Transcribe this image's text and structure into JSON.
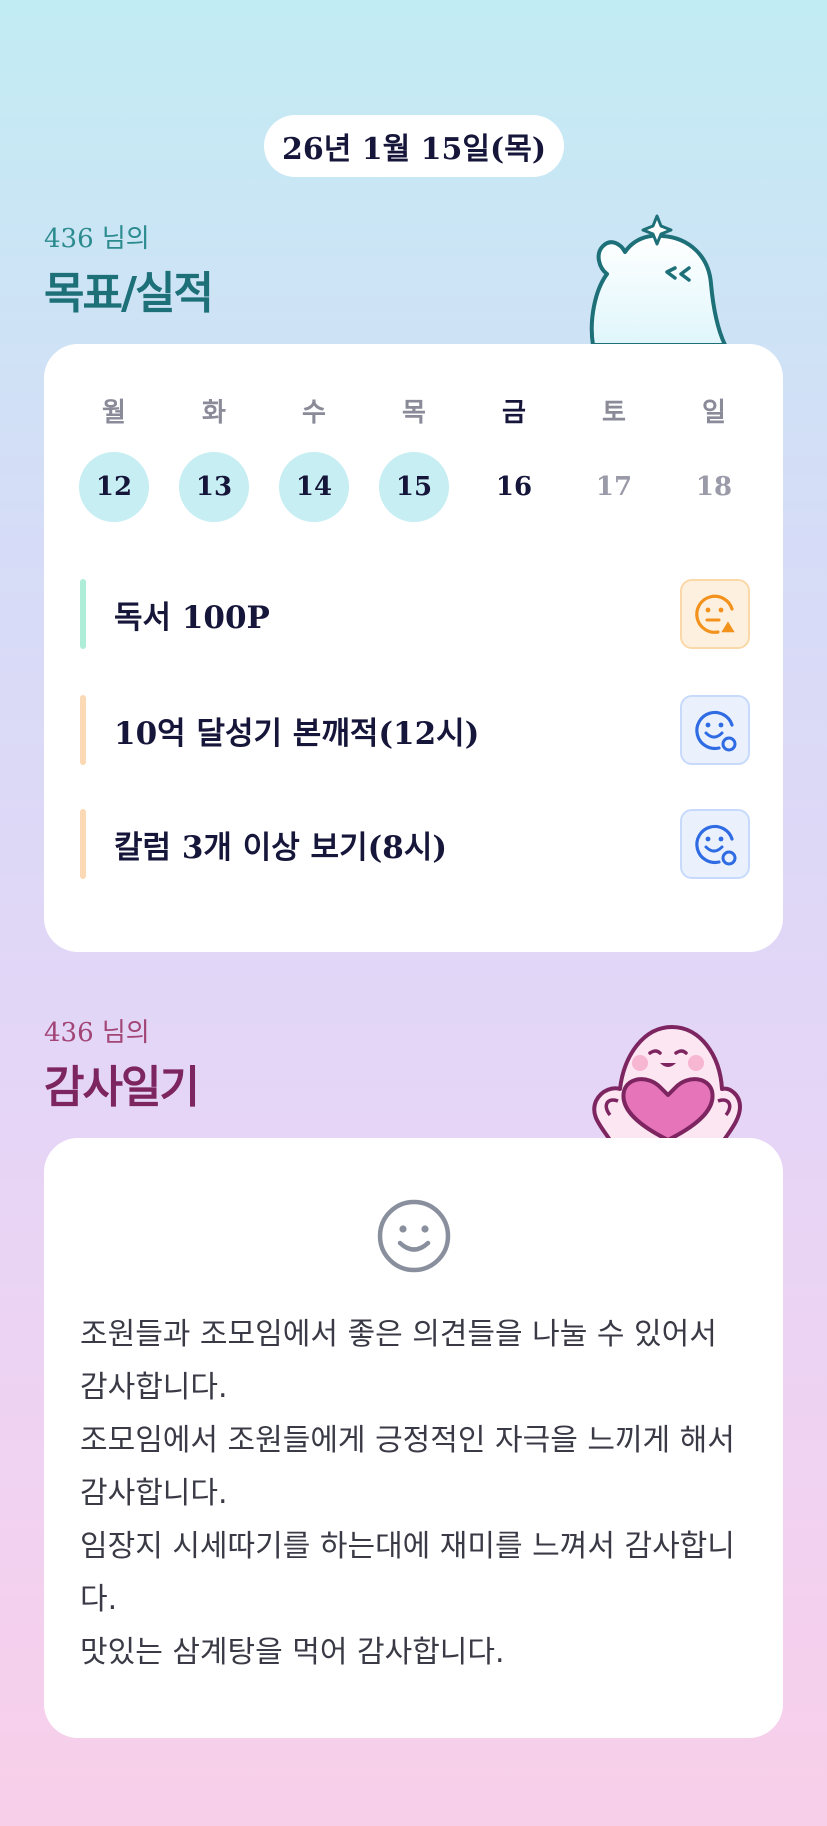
{
  "date_label": "26년 1월 15일(목)",
  "goals_section": {
    "user_line": "436 님의",
    "title": "목표/실적"
  },
  "week": [
    {
      "name": "월",
      "date": "12",
      "state": "done"
    },
    {
      "name": "화",
      "date": "13",
      "state": "done"
    },
    {
      "name": "수",
      "date": "14",
      "state": "done"
    },
    {
      "name": "목",
      "date": "15",
      "state": "done"
    },
    {
      "name": "금",
      "date": "16",
      "state": "today"
    },
    {
      "name": "토",
      "date": "17",
      "state": "future"
    },
    {
      "name": "일",
      "date": "18",
      "state": "future"
    }
  ],
  "goals": [
    {
      "label": "독서 100P",
      "status_icon": "warning-face-icon",
      "accent": "#aeeed8"
    },
    {
      "label": "10억 달성기 본깨적(12시)",
      "status_icon": "smile-check-icon",
      "accent": "#fbd9b4"
    },
    {
      "label": "칼럼 3개 이상 보기(8시)",
      "status_icon": "smile-check-icon",
      "accent": "#fbd9b4"
    }
  ],
  "gratitude_section": {
    "user_line": "436 님의",
    "title": "감사일기",
    "mood_icon": "smile-face-icon",
    "entries": [
      "조원들과 조모임에서 좋은 의견들을 나눌 수 있어서 감사합니다.",
      "조모임에서 조원들에게 긍정적인 자극을 느끼게 해서 감사합니다.",
      "임장지 시세따기를 하는대에 재미를 느껴서 감사합니다.",
      "맛있는 삼계탕을 먹어 감사합니다."
    ]
  },
  "colors": {
    "done_day": "#c6eef3",
    "goals_title": "#1d6f78",
    "gratitude_title": "#7d2560",
    "warning": "#f2921c",
    "ok": "#2f6be3"
  }
}
